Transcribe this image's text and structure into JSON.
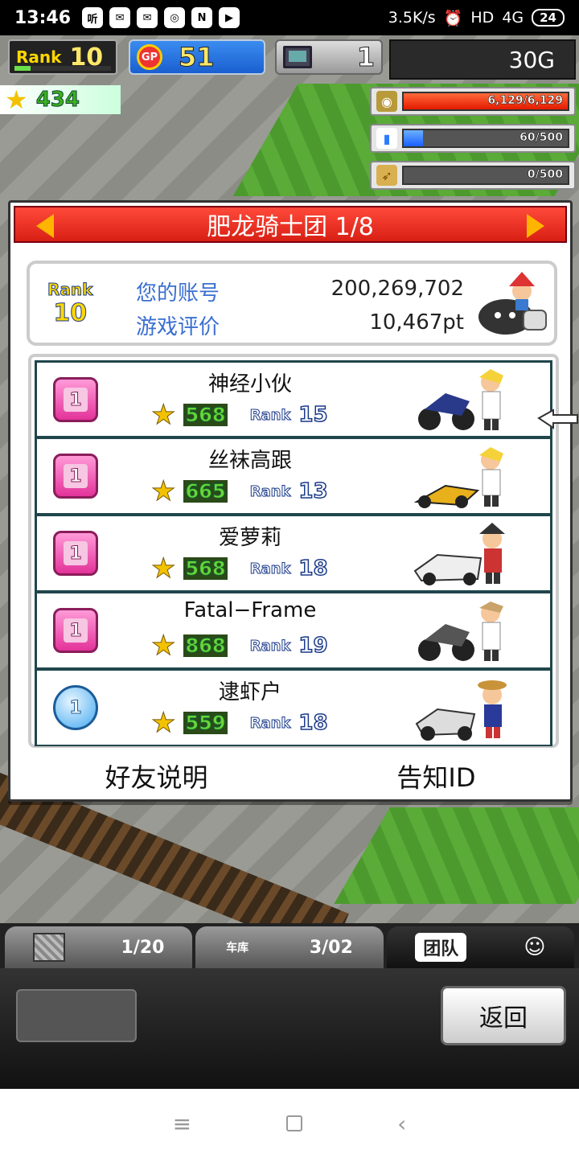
{
  "status_bar": {
    "time": "13:46",
    "app_icons": [
      "听",
      "✉",
      "✉",
      "◎",
      "N",
      "▶"
    ],
    "speed": "3.5K/s",
    "alarm_icon": "⏰",
    "hd": "HD",
    "network": "4G",
    "battery": "24"
  },
  "hud": {
    "rank_label": "Rank",
    "rank_value": "10",
    "gp_label": "GP",
    "gp_value": "51",
    "pc_value": "1",
    "money": "30G",
    "fans": "434",
    "resources": [
      {
        "icon": "coins-icon",
        "text": "6,129/6,129",
        "fill": 1.0,
        "color": "#ff3a1a"
      },
      {
        "icon": "fuel-icon",
        "text": "60/500",
        "fill": 0.12,
        "color": "#2a7cff"
      },
      {
        "icon": "feather-icon",
        "text": "0/500",
        "fill": 0.0,
        "color": "#ffcc00"
      }
    ]
  },
  "panel": {
    "title": "肥龙骑士团 1/8",
    "account": {
      "rank_label": "Rank",
      "rank_value": "10",
      "account_label": "您的账号",
      "account_value": "200,269,702",
      "rating_label": "游戏评价",
      "rating_value": "10,467pt"
    },
    "friends": [
      {
        "name": "神经小伙",
        "badge": "1",
        "badge_type": "pink",
        "score": "568",
        "rank_label": "Rank",
        "rank": "15"
      },
      {
        "name": "丝袜高跟",
        "badge": "1",
        "badge_type": "pink",
        "score": "665",
        "rank_label": "Rank",
        "rank": "13"
      },
      {
        "name": "爱萝莉",
        "badge": "1",
        "badge_type": "pink",
        "score": "568",
        "rank_label": "Rank",
        "rank": "18"
      },
      {
        "name": "Fatal−Frame",
        "badge": "1",
        "badge_type": "pink",
        "score": "868",
        "rank_label": "Rank",
        "rank": "19"
      },
      {
        "name": "逮虾户",
        "badge": "1",
        "badge_type": "blue",
        "score": "559",
        "rank_label": "Rank",
        "rank": "18"
      }
    ],
    "footer": {
      "friend_help": "好友说明",
      "notify_id": "告知ID"
    }
  },
  "bottom": {
    "tab1_count": "1/20",
    "tab2_label": "车库",
    "tab2_count": "3/02",
    "tab3_label": "团队",
    "back_label": "返回"
  },
  "nav": {
    "menu": "≡",
    "back": "‹"
  }
}
